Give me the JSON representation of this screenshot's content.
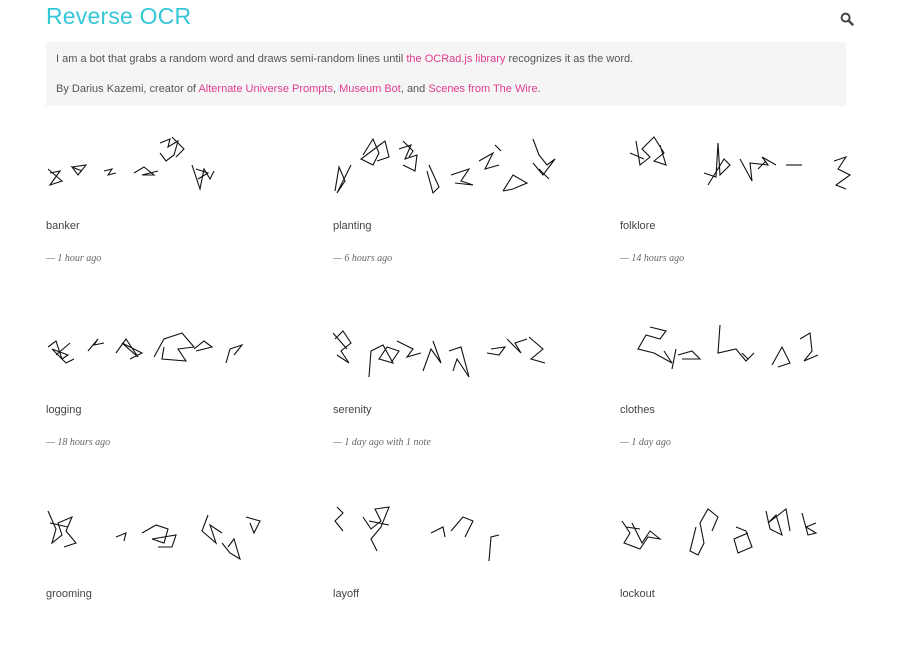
{
  "header": {
    "title": "Reverse OCR",
    "search_icon": "search-icon"
  },
  "intro": {
    "line1_prefix": "I am a bot that grabs a random word and draws semi-random lines until ",
    "line1_link": "the OCRad.js library",
    "line1_suffix": " recognizes it as the word.",
    "line2_prefix": "By Darius Kazemi, creator of ",
    "link_alternate": "Alternate Universe Prompts",
    "sep1": ", ",
    "link_museum": "Museum Bot",
    "sep2": ", and ",
    "link_wire": "Scenes from The Wire",
    "line2_suffix": "."
  },
  "posts": [
    {
      "word": "banker",
      "time": "— 1 hour ago"
    },
    {
      "word": "planting",
      "time": "— 6 hours ago"
    },
    {
      "word": "folklore",
      "time": "— 14 hours ago"
    },
    {
      "word": "logging",
      "time": "— 18 hours ago"
    },
    {
      "word": "serenity",
      "time": "— 1 day ago with 1 note"
    },
    {
      "word": "clothes",
      "time": "— 1 day ago"
    },
    {
      "word": "grooming",
      "time": ""
    },
    {
      "word": "layoff",
      "time": ""
    },
    {
      "word": "lockout",
      "time": ""
    }
  ],
  "colors": {
    "title": "#34c7d8",
    "link": "#e23c8f",
    "intro_bg": "#f5f5f5"
  }
}
